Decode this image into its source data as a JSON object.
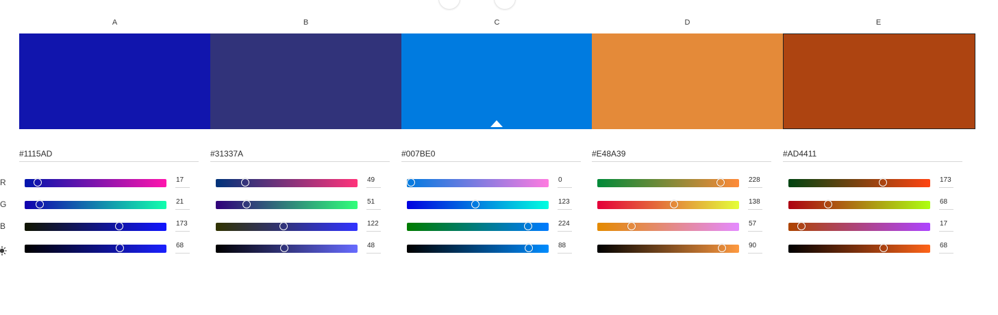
{
  "columns": [
    {
      "letter": "A",
      "hex": "#1115AD",
      "color": "#1115AD",
      "selected": false,
      "bordered": false,
      "values": {
        "r": "17",
        "g": "21",
        "b": "173",
        "brightness": "68"
      },
      "gradients": {
        "r": [
          "#0015AD",
          "#FF15AD"
        ],
        "g": [
          "#1100AD",
          "#11FFAD"
        ],
        "b": [
          "#111500",
          "#1115FF"
        ],
        "brightness": [
          "#000000",
          "#1A20FF"
        ]
      }
    },
    {
      "letter": "B",
      "hex": "#31337A",
      "color": "#31337A",
      "selected": false,
      "bordered": false,
      "values": {
        "r": "49",
        "g": "51",
        "b": "122",
        "brightness": "48"
      },
      "gradients": {
        "r": [
          "#00337A",
          "#FF337A"
        ],
        "g": [
          "#31007A",
          "#31FF7A"
        ],
        "b": [
          "#313300",
          "#3133FF"
        ],
        "brightness": [
          "#000000",
          "#676BFF"
        ]
      }
    },
    {
      "letter": "C",
      "hex": "#007BE0",
      "color": "#007BE0",
      "selected": true,
      "bordered": false,
      "values": {
        "r": "0",
        "g": "123",
        "b": "224",
        "brightness": "88"
      },
      "gradients": {
        "r": [
          "#007BE0",
          "#FF7BE0"
        ],
        "g": [
          "#0000E0",
          "#00FFE0"
        ],
        "b": [
          "#007B00",
          "#007BFF"
        ],
        "brightness": [
          "#000000",
          "#008CFF"
        ]
      }
    },
    {
      "letter": "D",
      "hex": "#E48A39",
      "color": "#E48A39",
      "selected": false,
      "bordered": false,
      "values": {
        "r": "228",
        "g": "138",
        "b": "57",
        "brightness": "90"
      },
      "gradients": {
        "r": [
          "#008A39",
          "#FF8A39"
        ],
        "g": [
          "#E40039",
          "#E4FF39"
        ],
        "b": [
          "#E48A00",
          "#E48AFF"
        ],
        "brightness": [
          "#000000",
          "#FF9A40"
        ]
      }
    },
    {
      "letter": "E",
      "hex": "#AD4411",
      "color": "#AD4411",
      "selected": false,
      "bordered": true,
      "values": {
        "r": "173",
        "g": "68",
        "b": "17",
        "brightness": "68"
      },
      "gradients": {
        "r": [
          "#004411",
          "#FF4411"
        ],
        "g": [
          "#AD0011",
          "#ADFF11"
        ],
        "b": [
          "#AD4400",
          "#AD44FF"
        ],
        "brightness": [
          "#000000",
          "#FF6419"
        ]
      }
    }
  ],
  "row_labels": {
    "r": "R",
    "g": "G",
    "b": "B"
  },
  "icons": {
    "brightness": "sun-icon"
  }
}
